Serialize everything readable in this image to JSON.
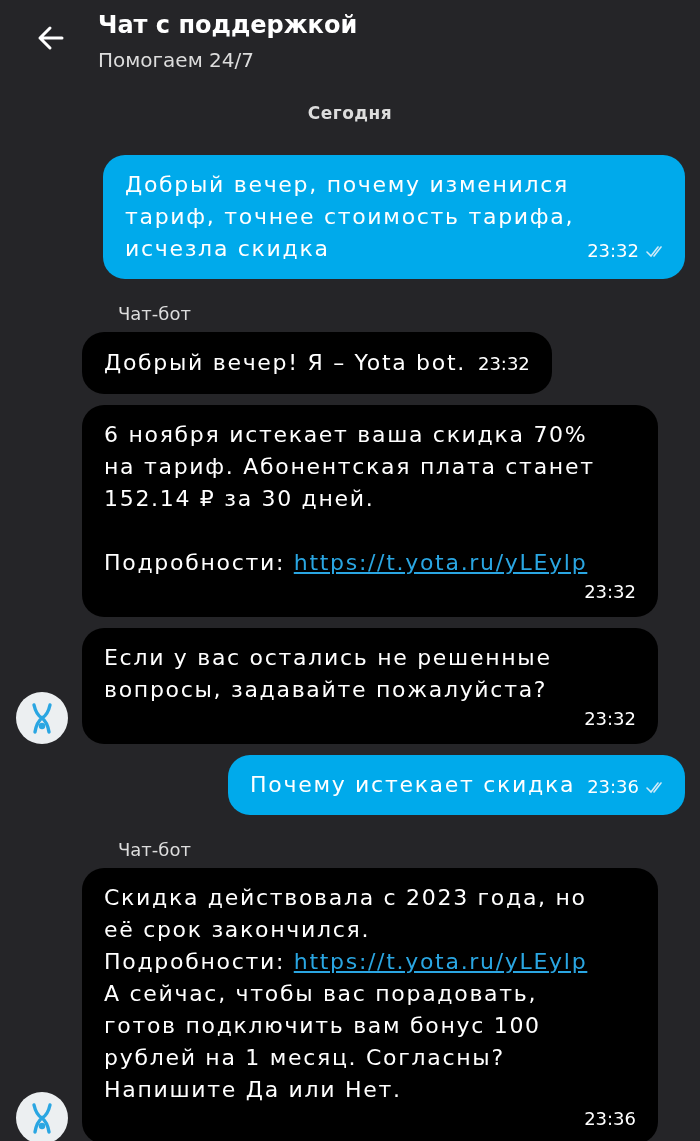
{
  "header": {
    "title": "Чат с поддержкой",
    "subtitle": "Помогаем 24/7"
  },
  "date_divider": "Сегодня",
  "messages": [
    {
      "kind": "out",
      "text": "Добрый вечер, почему изменился\nтариф, точнее стоимость тарифа,\nисчезла скидка",
      "time": "23:32",
      "read": true
    },
    {
      "kind": "in",
      "sender": "Чат-бот",
      "text": "Добрый вечер! Я – Yota bot.",
      "time": "23:32",
      "avatar": false
    },
    {
      "kind": "in",
      "paragraphs": [
        {
          "text": "6 ноября истекает ваша скидка 70%\nна тариф. Абонентская плата станет\n152.14 ₽ за 30 дней."
        },
        {
          "text": "Подробности: ",
          "link": "https://t.yota.ru/yLEylp"
        }
      ],
      "time": "23:32",
      "avatar": false
    },
    {
      "kind": "in",
      "text": "Если у вас остались не решенные\nвопросы, задавайте пожалуйста?",
      "time": "23:32",
      "avatar": true
    },
    {
      "kind": "out",
      "text": "Почему истекает скидка",
      "time": "23:36",
      "read": true
    },
    {
      "kind": "in",
      "sender": "Чат-бот",
      "paragraphs": [
        {
          "text": "Скидка действовала с 2023 года, но\neё срок закончился.\nПодробности: ",
          "link": "https://t.yota.ru/yLEylp",
          "after": "\nА сейчас, чтобы вас порадовать,\nготов подключить вам бонус 100\nрублей на 1 месяц. Согласны?\nНапишите Да или Нет."
        }
      ],
      "time": "23:36",
      "avatar": true
    }
  ]
}
